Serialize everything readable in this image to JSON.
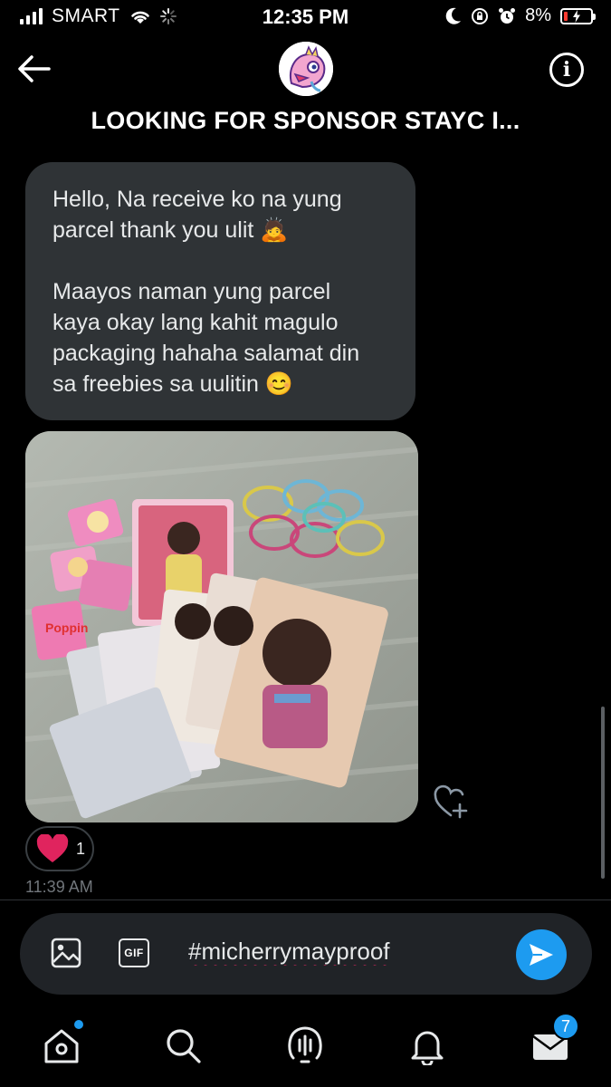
{
  "status_bar": {
    "carrier": "SMART",
    "time": "12:35 PM",
    "battery": "8%",
    "battery_color": "#ff3b30"
  },
  "header": {
    "title": "LOOKING FOR SPONSOR STAYC I...",
    "back_icon": "back-arrow-icon",
    "info_icon": "info-icon",
    "info_glyph": "i"
  },
  "message": {
    "lines_1": [
      "Hello, Na receive ko na yung",
      "parcel thank you ulit 🙇"
    ],
    "lines_2": [
      "Maayos naman yung parcel",
      "kaya okay lang kahit magulo",
      "packaging hahaha salamat din",
      "sa freebies sa uulitin 😊"
    ],
    "reaction_count": "1",
    "timestamp": "11:39 AM"
  },
  "composer": {
    "value": "#micherrymayproof",
    "gif_label": "GIF"
  },
  "tabbar": {
    "messages_badge": "7"
  },
  "colors": {
    "accent": "#1d9bf0",
    "bubble": "#2f3336",
    "heart": "#f91880"
  }
}
